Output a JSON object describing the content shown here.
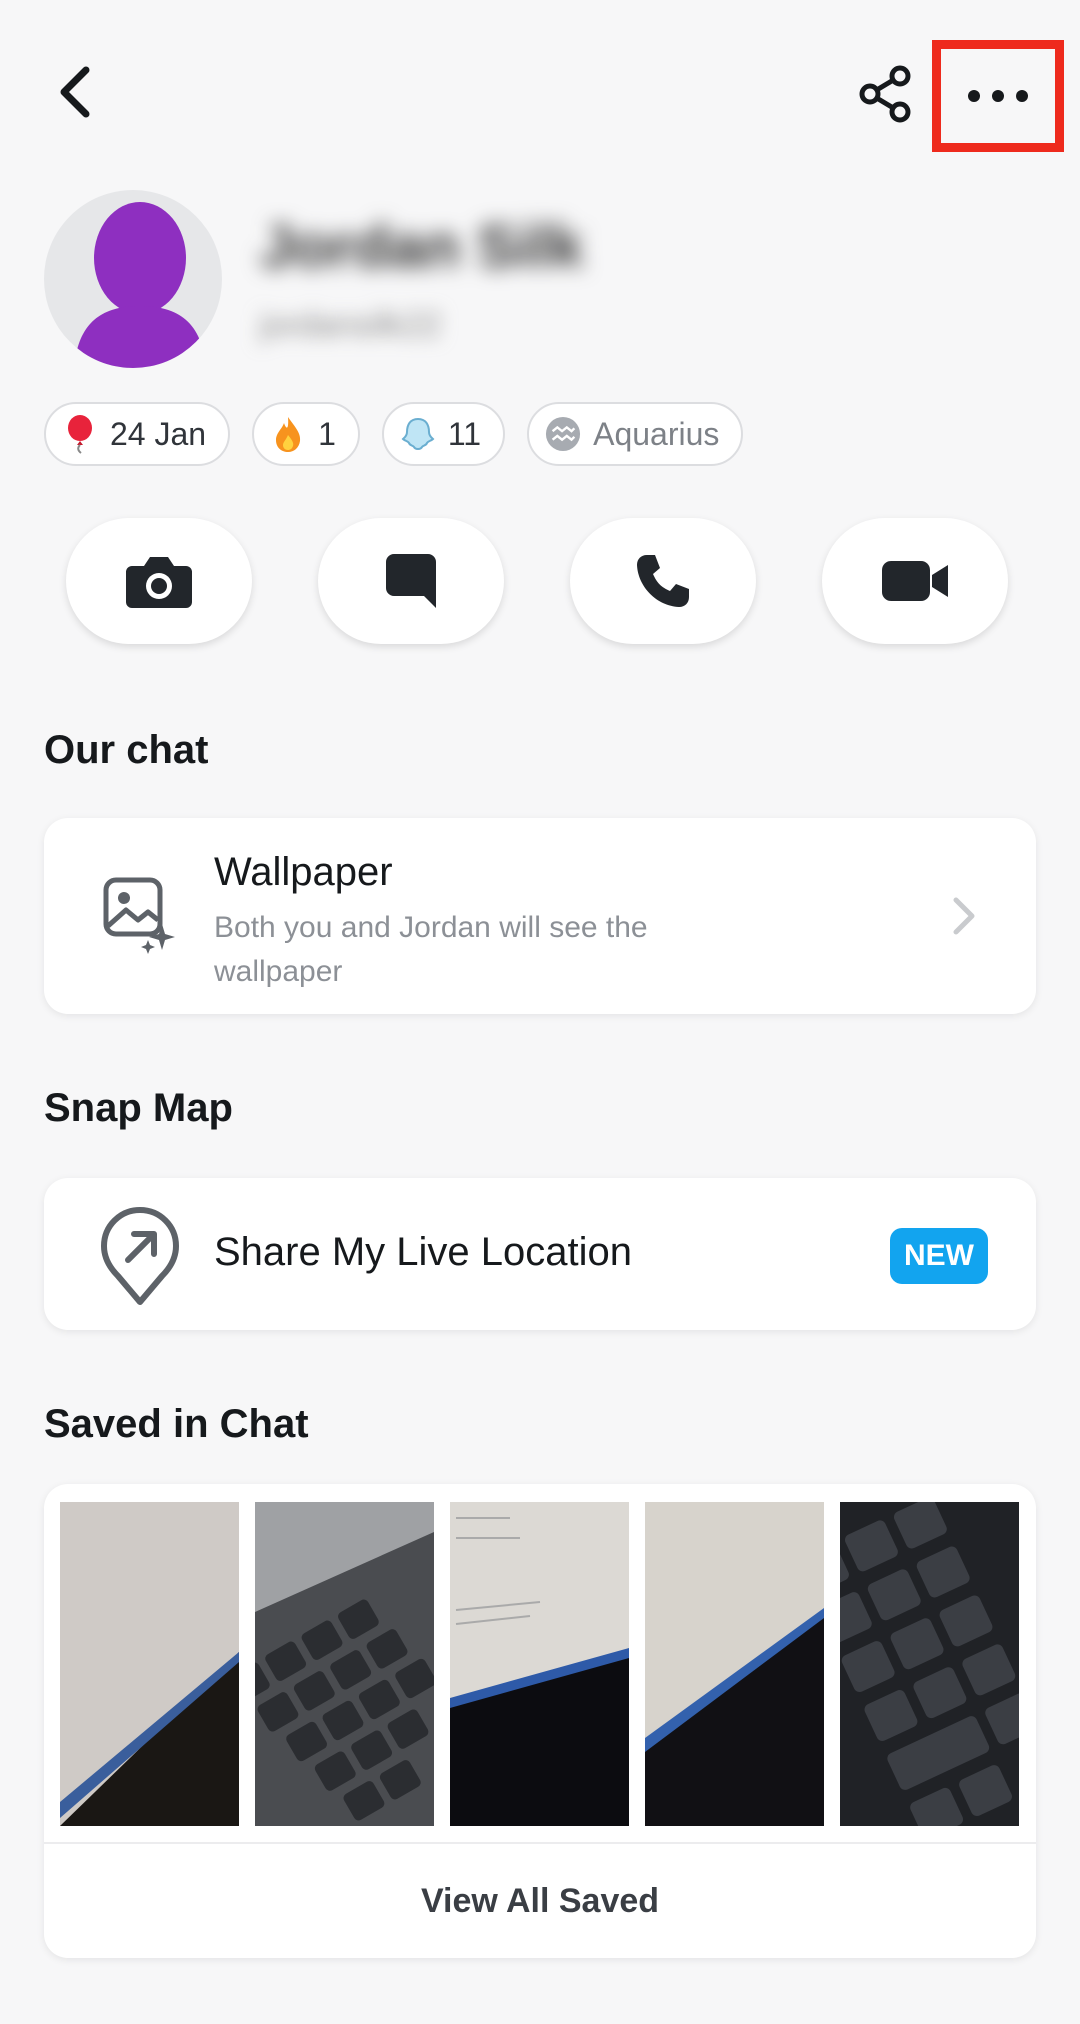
{
  "header": {
    "back_icon": "chevron-left-icon",
    "share_icon": "share-icon",
    "more_icon": "more-horizontal-icon",
    "highlight_color": "#ee2a1d"
  },
  "profile": {
    "display_name": "Jordan Silk",
    "username": "jordansilk22",
    "avatar_color": "#8e2fc0"
  },
  "badges": [
    {
      "icon": "balloon-icon",
      "label": "24 Jan"
    },
    {
      "icon": "fire-icon",
      "label": "1"
    },
    {
      "icon": "ghost-icon",
      "label": "11"
    },
    {
      "icon": "aquarius-icon",
      "label": "Aquarius"
    }
  ],
  "actions": [
    {
      "icon": "camera-icon"
    },
    {
      "icon": "chat-icon"
    },
    {
      "icon": "phone-icon"
    },
    {
      "icon": "video-icon"
    }
  ],
  "sections": {
    "our_chat": "Our chat",
    "snap_map": "Snap Map",
    "saved_in_chat": "Saved in Chat"
  },
  "wallpaper": {
    "title": "Wallpaper",
    "subtitle": "Both you and Jordan will see the wallpaper"
  },
  "location": {
    "label": "Share My Live Location",
    "badge": "NEW",
    "badge_color": "#12a4ef"
  },
  "saved": {
    "view_all": "View All Saved"
  }
}
